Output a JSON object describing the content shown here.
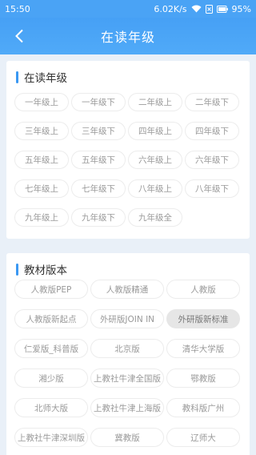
{
  "status": {
    "time": "15:50",
    "speed": "6.02K/s",
    "battery": "95%"
  },
  "nav": {
    "title": "在读年级",
    "back_icon": "chevron-left-icon"
  },
  "grade_section": {
    "heading": "在读年级",
    "items": [
      "一年级上",
      "一年级下",
      "二年级上",
      "二年级下",
      "三年级上",
      "三年级下",
      "四年级上",
      "四年级下",
      "五年级上",
      "五年级下",
      "六年级上",
      "六年级下",
      "七年级上",
      "七年级下",
      "八年级上",
      "八年级下",
      "九年级上",
      "九年级下",
      "九年级全"
    ]
  },
  "textbook_section": {
    "heading": "教材版本",
    "selected": "外研版新标准",
    "items": [
      "人教版PEP",
      "人教版精通",
      "人教版",
      "人教版新起点",
      "外研版JOIN IN",
      "外研版新标准",
      "仁爱版_科普版",
      "北京版",
      "清华大学版",
      "湘少版",
      "上教社牛津全国版",
      "鄂教版",
      "北师大版",
      "上教社牛津上海版",
      "教科版广州",
      "上教社牛津深圳版",
      "冀教版",
      "辽师大"
    ]
  },
  "colors": {
    "accent": "#4aa3f5",
    "section_bar": "#3a98f2",
    "background": "#e9f0f8"
  }
}
